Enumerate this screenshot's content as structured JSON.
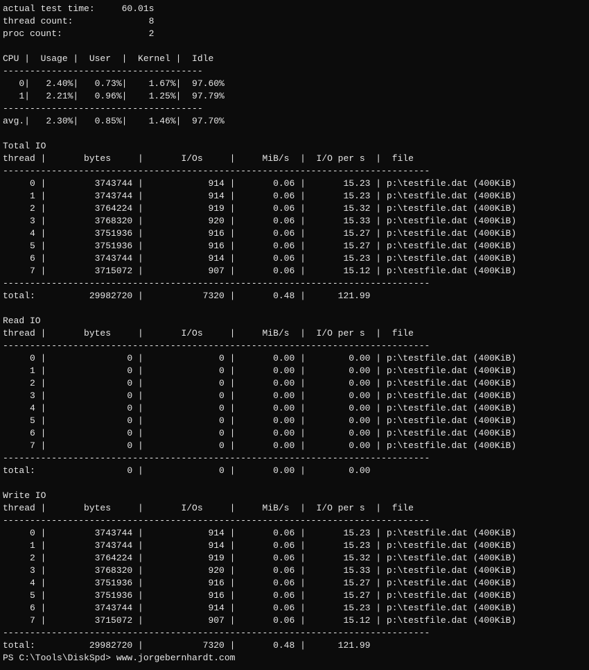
{
  "header": {
    "actual_test_time_label": "actual test time:",
    "actual_test_time_value": "60.01s",
    "thread_count_label": "thread count:",
    "thread_count_value": "8",
    "proc_count_label": "proc count:",
    "proc_count_value": "2"
  },
  "cpu": {
    "col_cpu": "CPU",
    "col_usage": "Usage",
    "col_user": "User",
    "col_kernel": "Kernel",
    "col_idle": "Idle",
    "rows": [
      {
        "id": "0",
        "usage": "2.40%",
        "user": "0.73%",
        "kernel": "1.67%",
        "idle": "97.60%"
      },
      {
        "id": "1",
        "usage": "2.21%",
        "user": "0.96%",
        "kernel": "1.25%",
        "idle": "97.79%"
      }
    ],
    "avg_label": "avg.",
    "avg_usage": "2.30%",
    "avg_user": "0.85%",
    "avg_kernel": "1.46%",
    "avg_idle": "97.70%"
  },
  "io_headers": {
    "thread": "thread",
    "bytes": "bytes",
    "ios": "I/Os",
    "mibs": "MiB/s",
    "iops": "I/O per s",
    "file": "file"
  },
  "file_path": "p:\\testfile.dat (400KiB)",
  "sections": {
    "total_io": {
      "title": "Total IO",
      "rows": [
        {
          "t": "0",
          "bytes": "3743744",
          "ios": "914",
          "mibs": "0.06",
          "iops": "15.23"
        },
        {
          "t": "1",
          "bytes": "3743744",
          "ios": "914",
          "mibs": "0.06",
          "iops": "15.23"
        },
        {
          "t": "2",
          "bytes": "3764224",
          "ios": "919",
          "mibs": "0.06",
          "iops": "15.32"
        },
        {
          "t": "3",
          "bytes": "3768320",
          "ios": "920",
          "mibs": "0.06",
          "iops": "15.33"
        },
        {
          "t": "4",
          "bytes": "3751936",
          "ios": "916",
          "mibs": "0.06",
          "iops": "15.27"
        },
        {
          "t": "5",
          "bytes": "3751936",
          "ios": "916",
          "mibs": "0.06",
          "iops": "15.27"
        },
        {
          "t": "6",
          "bytes": "3743744",
          "ios": "914",
          "mibs": "0.06",
          "iops": "15.23"
        },
        {
          "t": "7",
          "bytes": "3715072",
          "ios": "907",
          "mibs": "0.06",
          "iops": "15.12"
        }
      ],
      "total": {
        "label": "total:",
        "bytes": "29982720",
        "ios": "7320",
        "mibs": "0.48",
        "iops": "121.99"
      }
    },
    "read_io": {
      "title": "Read IO",
      "rows": [
        {
          "t": "0",
          "bytes": "0",
          "ios": "0",
          "mibs": "0.00",
          "iops": "0.00"
        },
        {
          "t": "1",
          "bytes": "0",
          "ios": "0",
          "mibs": "0.00",
          "iops": "0.00"
        },
        {
          "t": "2",
          "bytes": "0",
          "ios": "0",
          "mibs": "0.00",
          "iops": "0.00"
        },
        {
          "t": "3",
          "bytes": "0",
          "ios": "0",
          "mibs": "0.00",
          "iops": "0.00"
        },
        {
          "t": "4",
          "bytes": "0",
          "ios": "0",
          "mibs": "0.00",
          "iops": "0.00"
        },
        {
          "t": "5",
          "bytes": "0",
          "ios": "0",
          "mibs": "0.00",
          "iops": "0.00"
        },
        {
          "t": "6",
          "bytes": "0",
          "ios": "0",
          "mibs": "0.00",
          "iops": "0.00"
        },
        {
          "t": "7",
          "bytes": "0",
          "ios": "0",
          "mibs": "0.00",
          "iops": "0.00"
        }
      ],
      "total": {
        "label": "total:",
        "bytes": "0",
        "ios": "0",
        "mibs": "0.00",
        "iops": "0.00"
      }
    },
    "write_io": {
      "title": "Write IO",
      "rows": [
        {
          "t": "0",
          "bytes": "3743744",
          "ios": "914",
          "mibs": "0.06",
          "iops": "15.23"
        },
        {
          "t": "1",
          "bytes": "3743744",
          "ios": "914",
          "mibs": "0.06",
          "iops": "15.23"
        },
        {
          "t": "2",
          "bytes": "3764224",
          "ios": "919",
          "mibs": "0.06",
          "iops": "15.32"
        },
        {
          "t": "3",
          "bytes": "3768320",
          "ios": "920",
          "mibs": "0.06",
          "iops": "15.33"
        },
        {
          "t": "4",
          "bytes": "3751936",
          "ios": "916",
          "mibs": "0.06",
          "iops": "15.27"
        },
        {
          "t": "5",
          "bytes": "3751936",
          "ios": "916",
          "mibs": "0.06",
          "iops": "15.27"
        },
        {
          "t": "6",
          "bytes": "3743744",
          "ios": "914",
          "mibs": "0.06",
          "iops": "15.23"
        },
        {
          "t": "7",
          "bytes": "3715072",
          "ios": "907",
          "mibs": "0.06",
          "iops": "15.12"
        }
      ],
      "total": {
        "label": "total:",
        "bytes": "29982720",
        "ios": "7320",
        "mibs": "0.48",
        "iops": "121.99"
      }
    }
  },
  "prompt": {
    "path": "PS C:\\Tools\\DiskSpd>",
    "typed": "www.jorgebernhardt.com"
  }
}
